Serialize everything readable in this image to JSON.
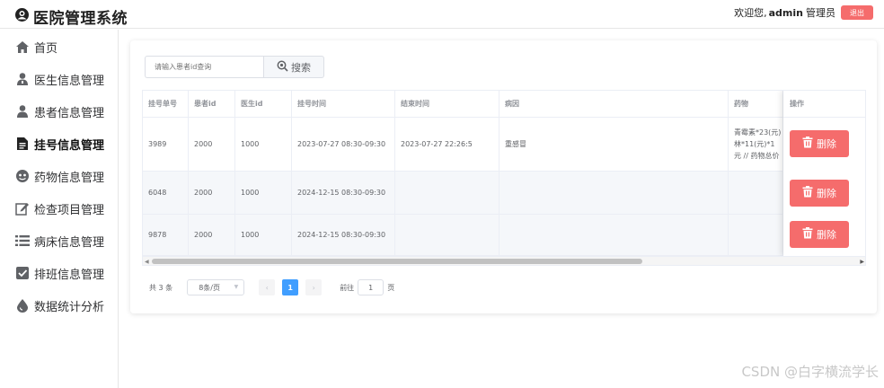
{
  "header": {
    "title": "医院管理系统",
    "welcome": "欢迎您,",
    "username": "admin",
    "role": "管理员",
    "logout_label": "退出"
  },
  "sidebar": {
    "items": [
      {
        "label": "首页",
        "icon": "home-icon"
      },
      {
        "label": "医生信息管理",
        "icon": "doctor-icon"
      },
      {
        "label": "患者信息管理",
        "icon": "patient-icon"
      },
      {
        "label": "挂号信息管理",
        "icon": "register-doc-icon",
        "active": true
      },
      {
        "label": "药物信息管理",
        "icon": "medicine-icon"
      },
      {
        "label": "检查项目管理",
        "icon": "edit-check-icon"
      },
      {
        "label": "病床信息管理",
        "icon": "list-icon"
      },
      {
        "label": "排班信息管理",
        "icon": "checkbox-icon"
      },
      {
        "label": "数据统计分析",
        "icon": "drop-icon"
      }
    ]
  },
  "search": {
    "placeholder": "请输入患者id查询",
    "button_label": "搜索"
  },
  "table": {
    "columns": [
      "挂号单号",
      "患者id",
      "医生id",
      "挂号时间",
      "结束时间",
      "病因",
      "药物",
      "操作"
    ],
    "rows": [
      {
        "id": "3989",
        "patient": "2000",
        "doctor": "1000",
        "reg_time": "2023-07-27 08:30-09:30",
        "end_time": "2023-07-27 22:26:5",
        "cause": "重感冒",
        "meds": "青霉素*23(元) 林*11(元)*1 元 // 药物总价"
      },
      {
        "id": "6048",
        "patient": "2000",
        "doctor": "1000",
        "reg_time": "2024-12-15 08:30-09:30",
        "end_time": "",
        "cause": "",
        "meds": ""
      },
      {
        "id": "9878",
        "patient": "2000",
        "doctor": "1000",
        "reg_time": "2024-12-15 08:30-09:30",
        "end_time": "",
        "cause": "",
        "meds": ""
      }
    ],
    "delete_label": "删除"
  },
  "pagination": {
    "total": "共 3 条",
    "page_size": "8条/页",
    "current_page": "1",
    "goto_label": "前往",
    "goto_value": "1",
    "page_suffix": "页"
  },
  "watermark": "CSDN @白字横流学长",
  "colors": {
    "danger": "#f56c6c",
    "primary": "#409eff"
  }
}
